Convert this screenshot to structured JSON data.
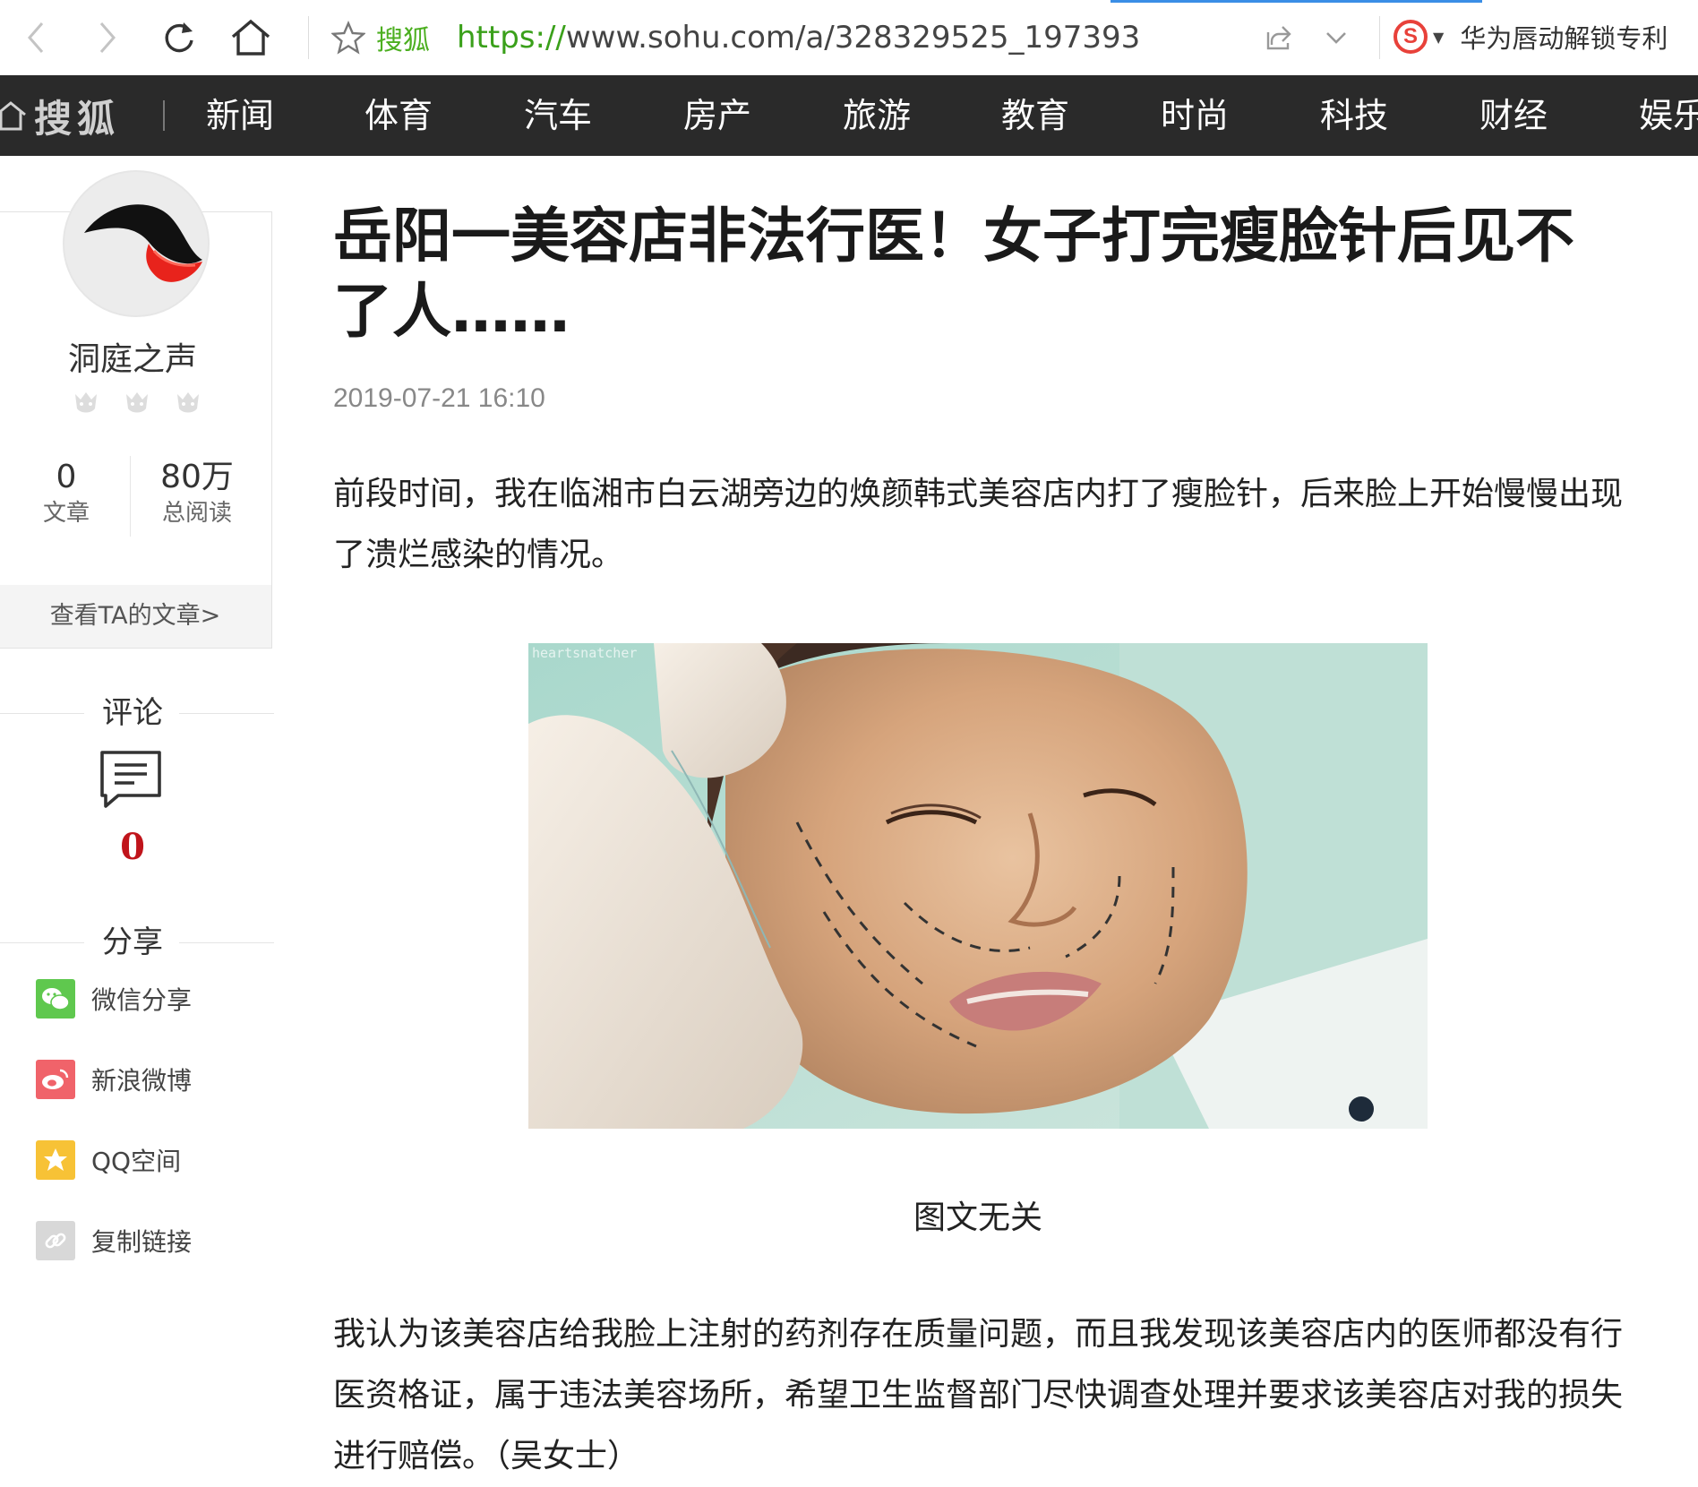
{
  "browser": {
    "site_name": "搜狐",
    "url_protocol": "https://",
    "url_rest": "www.sohu.com/a/328329525_197393",
    "search_engine_logo": "S",
    "search_hint": "华为唇动解锁专利",
    "icons": [
      "back-icon",
      "forward-icon",
      "reload-icon",
      "home-icon",
      "star-icon",
      "share-icon",
      "chevron-down-icon",
      "sogou-icon"
    ]
  },
  "nav": {
    "logo_text": "搜狐",
    "items": [
      "新闻",
      "体育",
      "汽车",
      "房产",
      "旅游",
      "教育",
      "时尚",
      "科技",
      "财经",
      "娱乐"
    ]
  },
  "author": {
    "name": "洞庭之声",
    "articles_count": "0",
    "articles_label": "文章",
    "reads_count": "80万",
    "reads_label": "总阅读",
    "view_articles": "查看TA的文章>"
  },
  "comments": {
    "title": "评论",
    "count": "0"
  },
  "share": {
    "title": "分享",
    "items": [
      {
        "label": "微信分享",
        "icon": "wechat-icon",
        "color": "#5fc84e"
      },
      {
        "label": "新浪微博",
        "icon": "weibo-icon",
        "color": "#f0636a"
      },
      {
        "label": "QQ空间",
        "icon": "qzone-icon",
        "color": "#f7c236"
      },
      {
        "label": "复制链接",
        "icon": "link-icon",
        "color": "#d8d8d8"
      }
    ]
  },
  "article": {
    "title": "岳阳一美容店非法行医！女子打完瘦脸针后见不了人……",
    "date": "2019-07-21 16:10",
    "paragraph1": "前段时间，我在临湘市白云湖旁边的焕颜韩式美容店内打了瘦脸针，后来脸上开始慢慢出现了溃烂感染的情况。",
    "image_watermark": "heartsnatcher",
    "image_caption": "图文无关",
    "paragraph2": "我认为该美容店给我脸上注射的药剂存在质量问题，而且我发现该美容店内的医师都没有行医资格证，属于违法美容场所，希望卫生监督部门尽快调查处理并要求该美容店对我的损失进行赔偿。（吴女士）"
  },
  "colors": {
    "nav_bg": "#2a2a2a",
    "url_green": "#3aa01a",
    "comment_red": "#c0141b"
  }
}
